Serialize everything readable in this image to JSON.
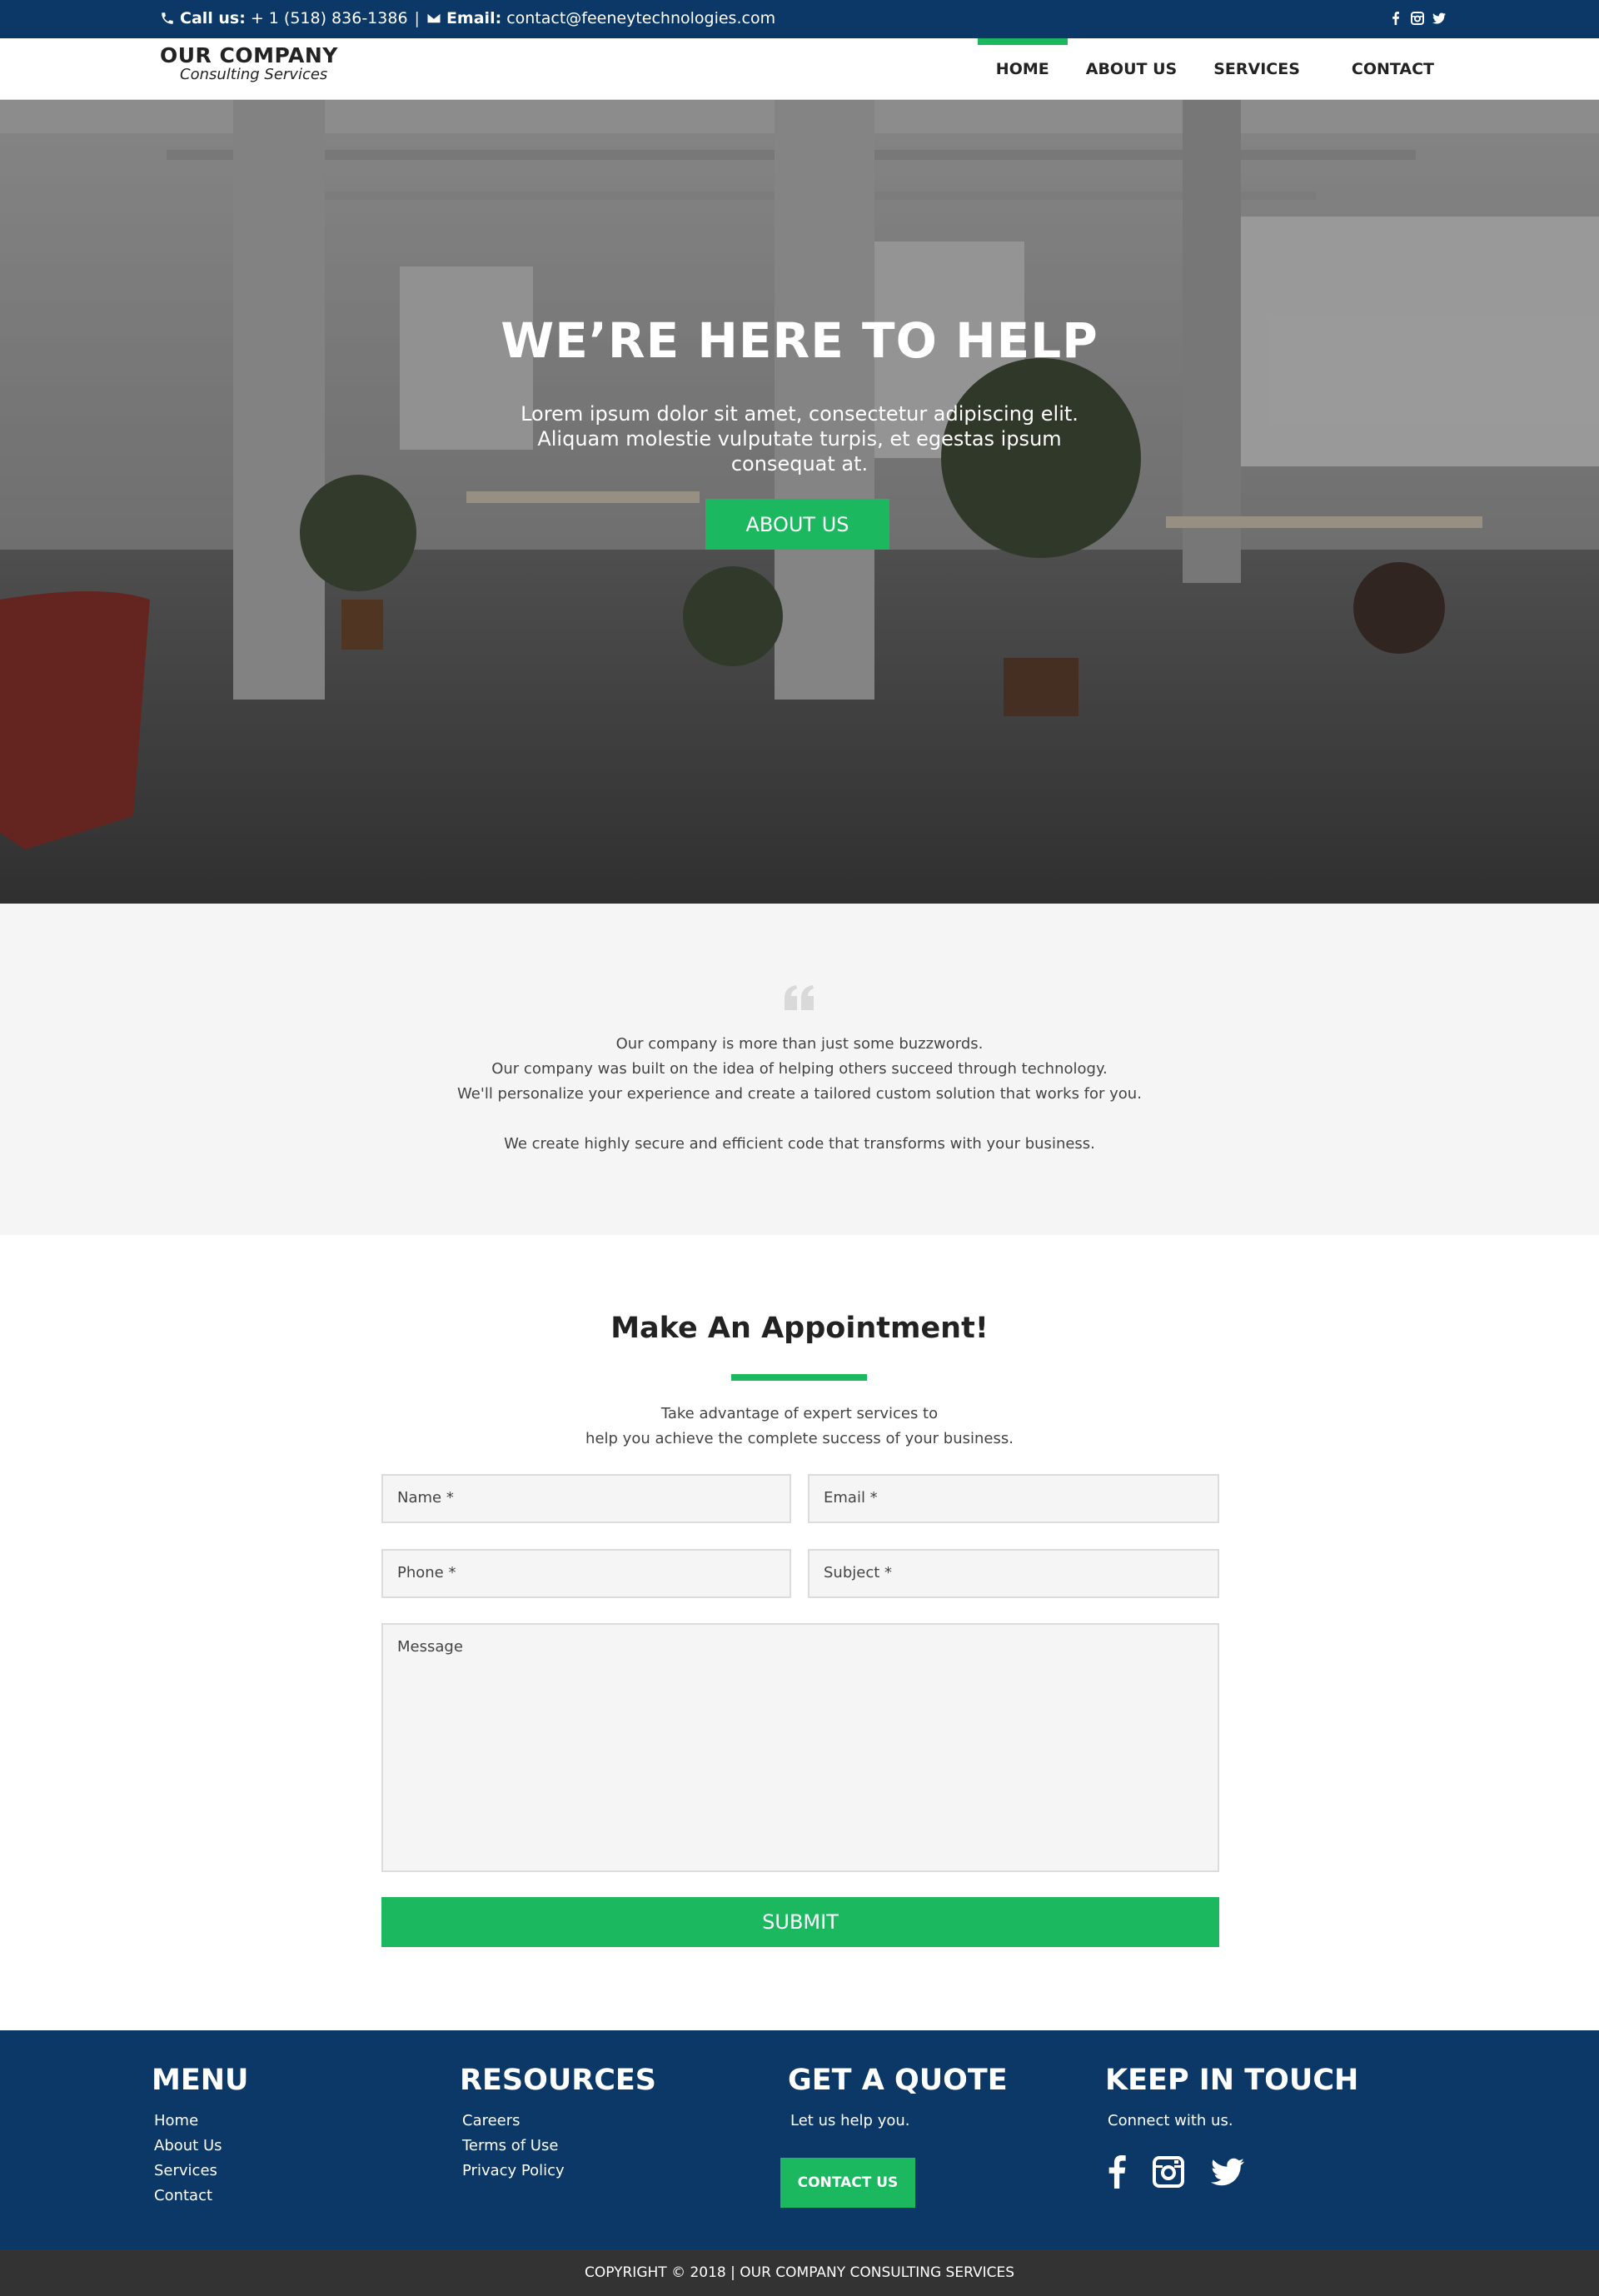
{
  "topbar": {
    "call_label": "Call us:",
    "phone": "+ 1 (518) 836-1386",
    "separator": "|",
    "email_label": "Email:",
    "email": "contact@feeneytechnologies.com",
    "social_icons": [
      "facebook-icon",
      "instagram-icon",
      "twitter-icon"
    ]
  },
  "header": {
    "logo_name": "OUR COMPANY",
    "logo_sub": "Consulting Services",
    "nav": [
      {
        "label": "HOME",
        "active": true
      },
      {
        "label": "ABOUT US",
        "active": false
      },
      {
        "label": "SERVICES",
        "active": false
      },
      {
        "label": "CONTACT",
        "active": false
      }
    ]
  },
  "hero": {
    "title": "WE’RE HERE TO HELP",
    "text": "Lorem ipsum dolor sit amet, consectetur adipiscing elit. Aliquam molestie vulputate turpis, et egestas ipsum consequat at.",
    "button": "ABOUT US"
  },
  "quote": {
    "lines": [
      "Our company is more than just some buzzwords.",
      "Our company was built on the idea of helping others succeed through technology.",
      "We'll personalize your experience and create a tailored custom solution that works for you."
    ],
    "closing": "We create highly secure and efficient code that transforms with your business."
  },
  "appointment": {
    "title": "Make An Appointment!",
    "desc_line1": "Take advantage of expert services to",
    "desc_line2": "help you achieve the complete success of your business.",
    "fields": {
      "name": "Name *",
      "email": "Email *",
      "phone": "Phone *",
      "subject": "Subject *",
      "message": "Message"
    },
    "submit": "SUBMIT"
  },
  "footer": {
    "menu": {
      "title": "MENU",
      "links": [
        "Home",
        "About Us",
        "Services",
        "Contact"
      ]
    },
    "resources": {
      "title": "RESOURCES",
      "links": [
        "Careers",
        "Terms of Use",
        "Privacy Policy"
      ]
    },
    "quote": {
      "title": "GET A QUOTE",
      "text": "Let us help you.",
      "button": "CONTACT US"
    },
    "touch": {
      "title": "KEEP IN TOUCH",
      "text": "Connect with us.",
      "icons": [
        "facebook-icon",
        "instagram-icon",
        "twitter-icon"
      ]
    }
  },
  "copyright": "COPYRIGHT © 2018 | OUR COMPANY CONSULTING SERVICES",
  "colors": {
    "navy": "#0b3866",
    "green": "#1cb860",
    "dark": "#333333",
    "light_bg": "#f5f5f5"
  }
}
